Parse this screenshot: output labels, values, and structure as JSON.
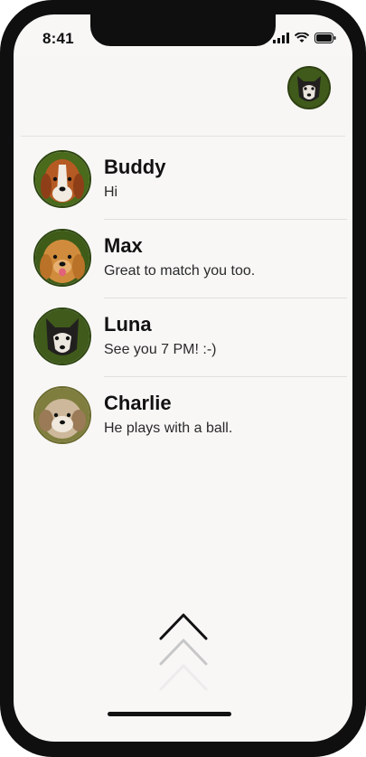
{
  "status": {
    "time": "8:41"
  },
  "matches": [
    {
      "name": "Buddy",
      "message": "Hi"
    },
    {
      "name": "Max",
      "message": "Great to match you too."
    },
    {
      "name": "Luna",
      "message": "See you 7 PM! :-)"
    },
    {
      "name": "Charlie",
      "message": "He plays with a ball."
    }
  ],
  "icons": {
    "signal": "signal-icon",
    "wifi": "wifi-icon",
    "battery": "battery-icon",
    "swipe": "chevron-up-icon"
  }
}
